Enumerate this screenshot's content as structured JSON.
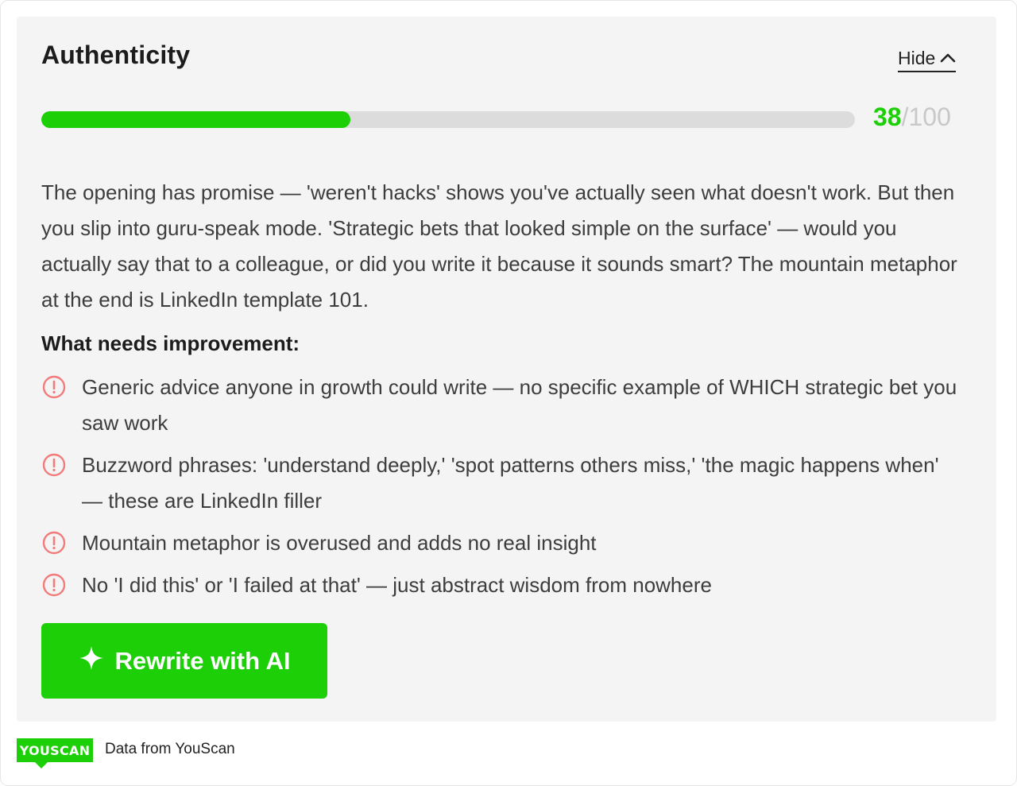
{
  "card": {
    "title": "Authenticity",
    "hide_label": "Hide",
    "score": {
      "value": "38",
      "separator": "/",
      "max": "100",
      "fraction": 0.38
    },
    "description": "The opening has promise — 'weren't hacks' shows you've actually seen what doesn't work. But then you slip into guru-speak mode. 'Strategic bets that looked simple on the surface' — would you actually say that to a colleague, or did you write it because it sounds smart? The mountain metaphor at the end is LinkedIn template 101.",
    "improvement_heading": "What needs improvement:",
    "issues": [
      "Generic advice anyone in growth could write — no specific example of WHICH strategic bet you saw work",
      "Buzzword phrases: 'understand deeply,' 'spot patterns others miss,' 'the magic happens when' — these are LinkedIn filler",
      "Mountain metaphor is overused and adds no real insight",
      "No 'I did this' or 'I failed at that' — just abstract wisdom from nowhere"
    ],
    "rewrite_label": "Rewrite with AI"
  },
  "footer": {
    "logo_text": "YOUSCAN",
    "text": "Data from YouScan"
  },
  "colors": {
    "accent": "#1ccf07",
    "warning": "#f27b7b",
    "track": "#dcdcdc",
    "card_bg": "#f4f4f4"
  },
  "icons": {
    "hide": "chevron-up-icon",
    "issue": "alert-circle-icon",
    "rewrite": "sparkle-icon"
  }
}
